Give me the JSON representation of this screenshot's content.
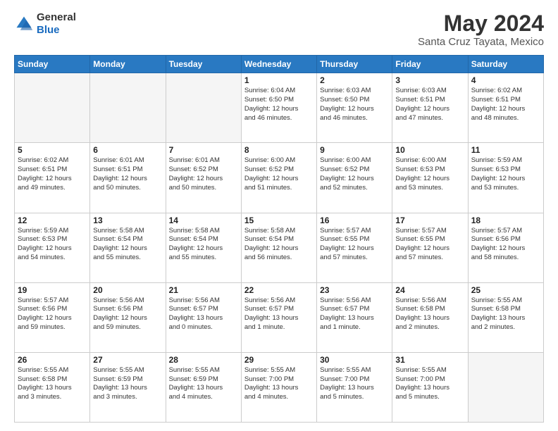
{
  "header": {
    "logo_general": "General",
    "logo_blue": "Blue",
    "title": "May 2024",
    "subtitle": "Santa Cruz Tayata, Mexico"
  },
  "calendar": {
    "days_of_week": [
      "Sunday",
      "Monday",
      "Tuesday",
      "Wednesday",
      "Thursday",
      "Friday",
      "Saturday"
    ],
    "weeks": [
      [
        {
          "day": "",
          "info": "",
          "empty": true
        },
        {
          "day": "",
          "info": "",
          "empty": true
        },
        {
          "day": "",
          "info": "",
          "empty": true
        },
        {
          "day": "1",
          "info": "Sunrise: 6:04 AM\nSunset: 6:50 PM\nDaylight: 12 hours\nand 46 minutes.",
          "empty": false
        },
        {
          "day": "2",
          "info": "Sunrise: 6:03 AM\nSunset: 6:50 PM\nDaylight: 12 hours\nand 46 minutes.",
          "empty": false
        },
        {
          "day": "3",
          "info": "Sunrise: 6:03 AM\nSunset: 6:51 PM\nDaylight: 12 hours\nand 47 minutes.",
          "empty": false
        },
        {
          "day": "4",
          "info": "Sunrise: 6:02 AM\nSunset: 6:51 PM\nDaylight: 12 hours\nand 48 minutes.",
          "empty": false
        }
      ],
      [
        {
          "day": "5",
          "info": "Sunrise: 6:02 AM\nSunset: 6:51 PM\nDaylight: 12 hours\nand 49 minutes.",
          "empty": false
        },
        {
          "day": "6",
          "info": "Sunrise: 6:01 AM\nSunset: 6:51 PM\nDaylight: 12 hours\nand 50 minutes.",
          "empty": false
        },
        {
          "day": "7",
          "info": "Sunrise: 6:01 AM\nSunset: 6:52 PM\nDaylight: 12 hours\nand 50 minutes.",
          "empty": false
        },
        {
          "day": "8",
          "info": "Sunrise: 6:00 AM\nSunset: 6:52 PM\nDaylight: 12 hours\nand 51 minutes.",
          "empty": false
        },
        {
          "day": "9",
          "info": "Sunrise: 6:00 AM\nSunset: 6:52 PM\nDaylight: 12 hours\nand 52 minutes.",
          "empty": false
        },
        {
          "day": "10",
          "info": "Sunrise: 6:00 AM\nSunset: 6:53 PM\nDaylight: 12 hours\nand 53 minutes.",
          "empty": false
        },
        {
          "day": "11",
          "info": "Sunrise: 5:59 AM\nSunset: 6:53 PM\nDaylight: 12 hours\nand 53 minutes.",
          "empty": false
        }
      ],
      [
        {
          "day": "12",
          "info": "Sunrise: 5:59 AM\nSunset: 6:53 PM\nDaylight: 12 hours\nand 54 minutes.",
          "empty": false
        },
        {
          "day": "13",
          "info": "Sunrise: 5:58 AM\nSunset: 6:54 PM\nDaylight: 12 hours\nand 55 minutes.",
          "empty": false
        },
        {
          "day": "14",
          "info": "Sunrise: 5:58 AM\nSunset: 6:54 PM\nDaylight: 12 hours\nand 55 minutes.",
          "empty": false
        },
        {
          "day": "15",
          "info": "Sunrise: 5:58 AM\nSunset: 6:54 PM\nDaylight: 12 hours\nand 56 minutes.",
          "empty": false
        },
        {
          "day": "16",
          "info": "Sunrise: 5:57 AM\nSunset: 6:55 PM\nDaylight: 12 hours\nand 57 minutes.",
          "empty": false
        },
        {
          "day": "17",
          "info": "Sunrise: 5:57 AM\nSunset: 6:55 PM\nDaylight: 12 hours\nand 57 minutes.",
          "empty": false
        },
        {
          "day": "18",
          "info": "Sunrise: 5:57 AM\nSunset: 6:56 PM\nDaylight: 12 hours\nand 58 minutes.",
          "empty": false
        }
      ],
      [
        {
          "day": "19",
          "info": "Sunrise: 5:57 AM\nSunset: 6:56 PM\nDaylight: 12 hours\nand 59 minutes.",
          "empty": false
        },
        {
          "day": "20",
          "info": "Sunrise: 5:56 AM\nSunset: 6:56 PM\nDaylight: 12 hours\nand 59 minutes.",
          "empty": false
        },
        {
          "day": "21",
          "info": "Sunrise: 5:56 AM\nSunset: 6:57 PM\nDaylight: 13 hours\nand 0 minutes.",
          "empty": false
        },
        {
          "day": "22",
          "info": "Sunrise: 5:56 AM\nSunset: 6:57 PM\nDaylight: 13 hours\nand 1 minute.",
          "empty": false
        },
        {
          "day": "23",
          "info": "Sunrise: 5:56 AM\nSunset: 6:57 PM\nDaylight: 13 hours\nand 1 minute.",
          "empty": false
        },
        {
          "day": "24",
          "info": "Sunrise: 5:56 AM\nSunset: 6:58 PM\nDaylight: 13 hours\nand 2 minutes.",
          "empty": false
        },
        {
          "day": "25",
          "info": "Sunrise: 5:55 AM\nSunset: 6:58 PM\nDaylight: 13 hours\nand 2 minutes.",
          "empty": false
        }
      ],
      [
        {
          "day": "26",
          "info": "Sunrise: 5:55 AM\nSunset: 6:58 PM\nDaylight: 13 hours\nand 3 minutes.",
          "empty": false
        },
        {
          "day": "27",
          "info": "Sunrise: 5:55 AM\nSunset: 6:59 PM\nDaylight: 13 hours\nand 3 minutes.",
          "empty": false
        },
        {
          "day": "28",
          "info": "Sunrise: 5:55 AM\nSunset: 6:59 PM\nDaylight: 13 hours\nand 4 minutes.",
          "empty": false
        },
        {
          "day": "29",
          "info": "Sunrise: 5:55 AM\nSunset: 7:00 PM\nDaylight: 13 hours\nand 4 minutes.",
          "empty": false
        },
        {
          "day": "30",
          "info": "Sunrise: 5:55 AM\nSunset: 7:00 PM\nDaylight: 13 hours\nand 5 minutes.",
          "empty": false
        },
        {
          "day": "31",
          "info": "Sunrise: 5:55 AM\nSunset: 7:00 PM\nDaylight: 13 hours\nand 5 minutes.",
          "empty": false
        },
        {
          "day": "",
          "info": "",
          "empty": true
        }
      ]
    ]
  }
}
